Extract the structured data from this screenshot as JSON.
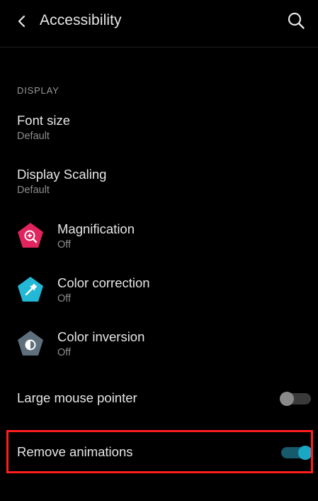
{
  "header": {
    "title": "Accessibility",
    "back_icon": "chevron-left-icon",
    "search_icon": "search-icon"
  },
  "section": {
    "title": "DISPLAY"
  },
  "items": [
    {
      "label": "Font size",
      "value": "Default"
    },
    {
      "label": "Display Scaling",
      "value": "Default"
    },
    {
      "label": "Magnification",
      "value": "Off",
      "icon": "magnification-icon",
      "icon_color": "#e0245e"
    },
    {
      "label": "Color correction",
      "value": "Off",
      "icon": "color-correction-icon",
      "icon_color": "#22b8d6"
    },
    {
      "label": "Color inversion",
      "value": "Off",
      "icon": "color-inversion-icon",
      "icon_color": "#5f6f7c"
    }
  ],
  "toggles": [
    {
      "label": "Large mouse pointer",
      "state": "off"
    },
    {
      "label": "Remove animations",
      "state": "on"
    }
  ],
  "colors": {
    "background": "#000000",
    "accent": "#1aa7c4",
    "highlight": "#ff1d1d"
  }
}
